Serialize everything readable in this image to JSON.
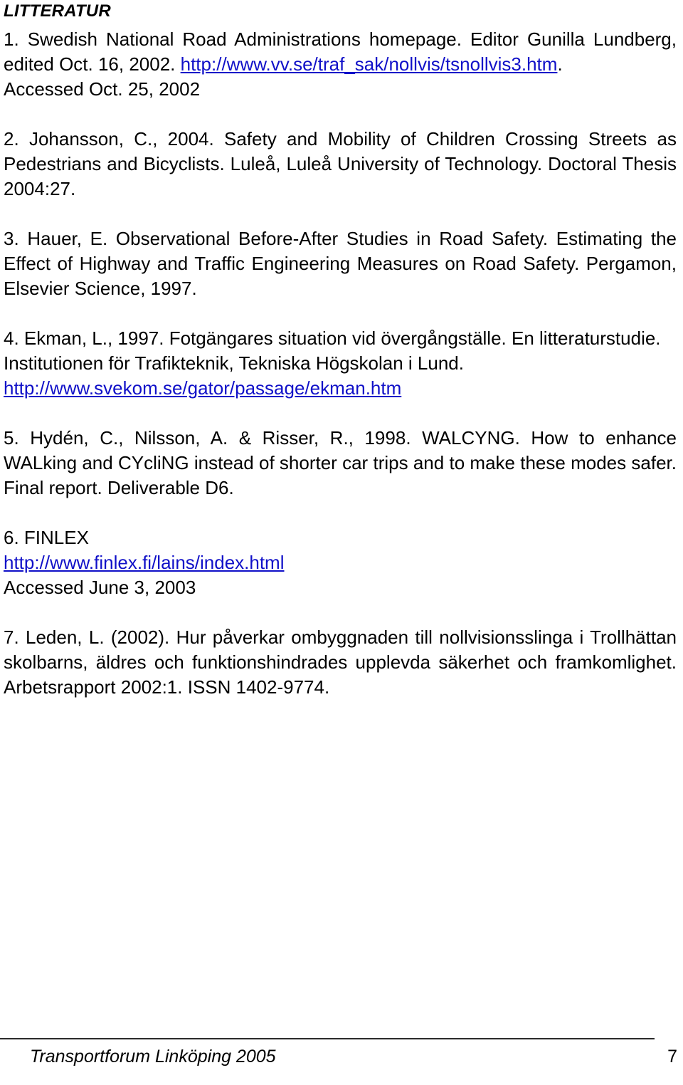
{
  "document": {
    "heading": "LITTERATUR",
    "link_color": "#1010C8",
    "text_color": "#000000",
    "background_color": "#FFFFFF"
  },
  "references": [
    {
      "id": "ref-1",
      "lines": [
        "1. Swedish National Road Administrations homepage. Editor Gunilla Lundberg, edited Oct. 16, 2002.",
        "http://www.vv.se/traf_sak/nollvis/tsnollvis3.htm",
        ".",
        "Accessed Oct. 25, 2002"
      ],
      "text_before_link": "1. Swedish National Road Administrations homepage. Editor Gunilla Lundberg, edited Oct. 16, 2002.",
      "link": "http://www.vv.se/traf_sak/nollvis/tsnollvis3.htm",
      "text_after_link": ".",
      "trailing": "Accessed Oct. 25, 2002"
    },
    {
      "id": "ref-2",
      "text": "2. Johansson, C., 2004. Safety and Mobility of Children Crossing Streets as Pedestrians and Bicyclists. Luleå, Luleå University of Technology. Doctoral Thesis 2004:27."
    },
    {
      "id": "ref-3",
      "text": "3. Hauer, E. Observational Before-After Studies in Road Safety. Estimating the Effect of Highway and Traffic Engineering Measures on Road Safety. Pergamon, Elsevier Science, 1997."
    },
    {
      "id": "ref-4",
      "text_before_link": "4. Ekman, L., 1997. Fotgängares situation vid övergångställe. En litteraturstudie. Institutionen för Trafikteknik, Tekniska Högskolan i Lund.",
      "link": "http://www.svekom.se/gator/passage/ekman.htm"
    },
    {
      "id": "ref-5",
      "text": "5. Hydén, C., Nilsson, A. & Risser, R., 1998. WALCYNG. How to enhance WALking and CYcliNG instead of shorter car trips and to make these modes safer. Final report. Deliverable D6."
    },
    {
      "id": "ref-6",
      "text_before_link": "6. FINLEX",
      "link": "http://www.finlex.fi/lains/index.html",
      "text_after_link": "Accessed June 3, 2003"
    },
    {
      "id": "ref-7",
      "text": "7. Leden, L. (2002). Hur påverkar ombyggnaden till nollvisionsslinga i Trollhättan skolbarns, äldres och funktionshindrades upplevda säkerhet och framkomlighet. Arbetsrapport 2002:1. ISSN 1402-9774."
    }
  ],
  "footer": {
    "title": "Transportforum Linköping 2005",
    "page_number": "7"
  }
}
